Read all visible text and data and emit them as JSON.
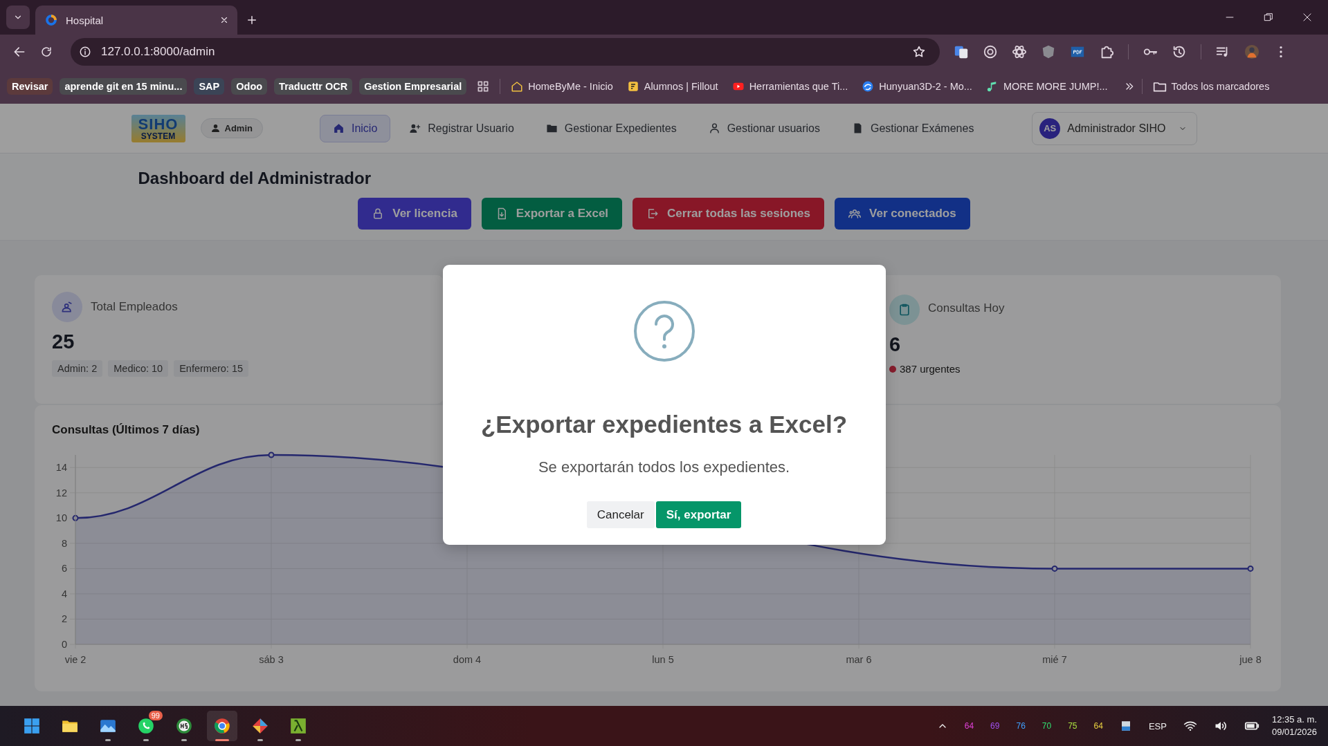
{
  "browser": {
    "tab": {
      "title": "Hospital"
    },
    "url": "127.0.0.1:8000/admin",
    "bookmarks": [
      {
        "kind": "group",
        "label": "Revisar",
        "color": "#5c3a3c"
      },
      {
        "kind": "group",
        "label": "aprende git en 15 minu...",
        "color": "#4a4a4e"
      },
      {
        "kind": "group",
        "label": "SAP",
        "color": "#3b4456"
      },
      {
        "kind": "group",
        "label": "Odoo",
        "color": "#4a4a4e"
      },
      {
        "kind": "group",
        "label": "Traducttr OCR",
        "color": "#4a4a4e"
      },
      {
        "kind": "group",
        "label": "Gestion Empresarial",
        "color": "#4a4a4e"
      },
      {
        "kind": "apps"
      },
      {
        "kind": "link",
        "label": "HomeByMe - Inicio"
      },
      {
        "kind": "link",
        "label": "Alumnos | Fillout"
      },
      {
        "kind": "link",
        "label": "Herramientas que Ti..."
      },
      {
        "kind": "link",
        "label": "Hunyuan3D-2 - Mo..."
      },
      {
        "kind": "link",
        "label": "MORE MORE JUMP!..."
      }
    ],
    "all_bookmarks": "Todos los marcadores"
  },
  "navbar": {
    "logo_top": "SIHO",
    "logo_bottom": "SYSTEM",
    "role": "Admin",
    "items": [
      {
        "label": "Inicio",
        "selected": true
      },
      {
        "label": "Registrar Usuario",
        "selected": false
      },
      {
        "label": "Gestionar Expedientes",
        "selected": false
      },
      {
        "label": "Gestionar usuarios",
        "selected": false
      },
      {
        "label": "Gestionar Exámenes",
        "selected": false
      }
    ],
    "user": {
      "initials": "AS",
      "name": "Administrador SIHO"
    }
  },
  "header": {
    "title": "Dashboard del Administrador",
    "actions": [
      {
        "label": "Ver licencia",
        "kind": "primary"
      },
      {
        "label": "Exportar a Excel",
        "kind": "success"
      },
      {
        "label": "Cerrar todas las sesiones",
        "kind": "danger"
      },
      {
        "label": "Ver conectados",
        "kind": "info"
      }
    ]
  },
  "stats": [
    {
      "kind": "tags",
      "title": "Total Empleados",
      "value": "25",
      "tags": [
        "Admin: 2",
        "Medico: 10",
        "Enfermero: 15"
      ]
    },
    {
      "kind": "alert",
      "title": "Consultas Hoy",
      "value": "6",
      "alert": "387 urgentes"
    }
  ],
  "chart_panel": {
    "title": "Consultas (Últimos 7 días)",
    "chart_data": {
      "type": "area",
      "categories": [
        "vie 2",
        "sáb 3",
        "dom 4",
        "lun 5",
        "mar 6",
        "mié 7",
        "jue 8"
      ],
      "series": [
        {
          "color": "#3b3fb0",
          "values": [
            10,
            15,
            null,
            null,
            null,
            6,
            6
          ]
        }
      ],
      "ylim": [
        0,
        15
      ],
      "yticks": [
        0,
        2,
        4,
        6,
        8,
        10,
        12,
        14
      ],
      "grid": true
    }
  },
  "modal": {
    "title": "¿Exportar expedientes a Excel?",
    "text": "Se exportarán todos los expedientes.",
    "buttons": [
      {
        "label": "Cancelar",
        "kind": "cancel"
      },
      {
        "label": "Sí, exportar",
        "kind": "confirm"
      }
    ]
  },
  "taskbar": {
    "apps": [
      {
        "selected": false,
        "running": false
      },
      {
        "selected": false,
        "running": true
      },
      {
        "selected": false,
        "running": true,
        "badge": "99"
      },
      {
        "selected": false,
        "running": true
      },
      {
        "selected": true,
        "running": true
      },
      {
        "selected": false,
        "running": true
      },
      {
        "selected": false,
        "running": true
      }
    ],
    "meters": [
      {
        "text": "64",
        "color": "#e040d8"
      },
      {
        "text": "69",
        "color": "#a050f0"
      },
      {
        "text": "76",
        "color": "#3fa0ff"
      },
      {
        "text": "70",
        "color": "#30e070"
      },
      {
        "text": "75",
        "color": "#a8e040"
      },
      {
        "text": "64",
        "color": "#e8d040"
      }
    ],
    "language": "ESP",
    "time": "12:35 a. m.",
    "date": "09/01/2026"
  }
}
